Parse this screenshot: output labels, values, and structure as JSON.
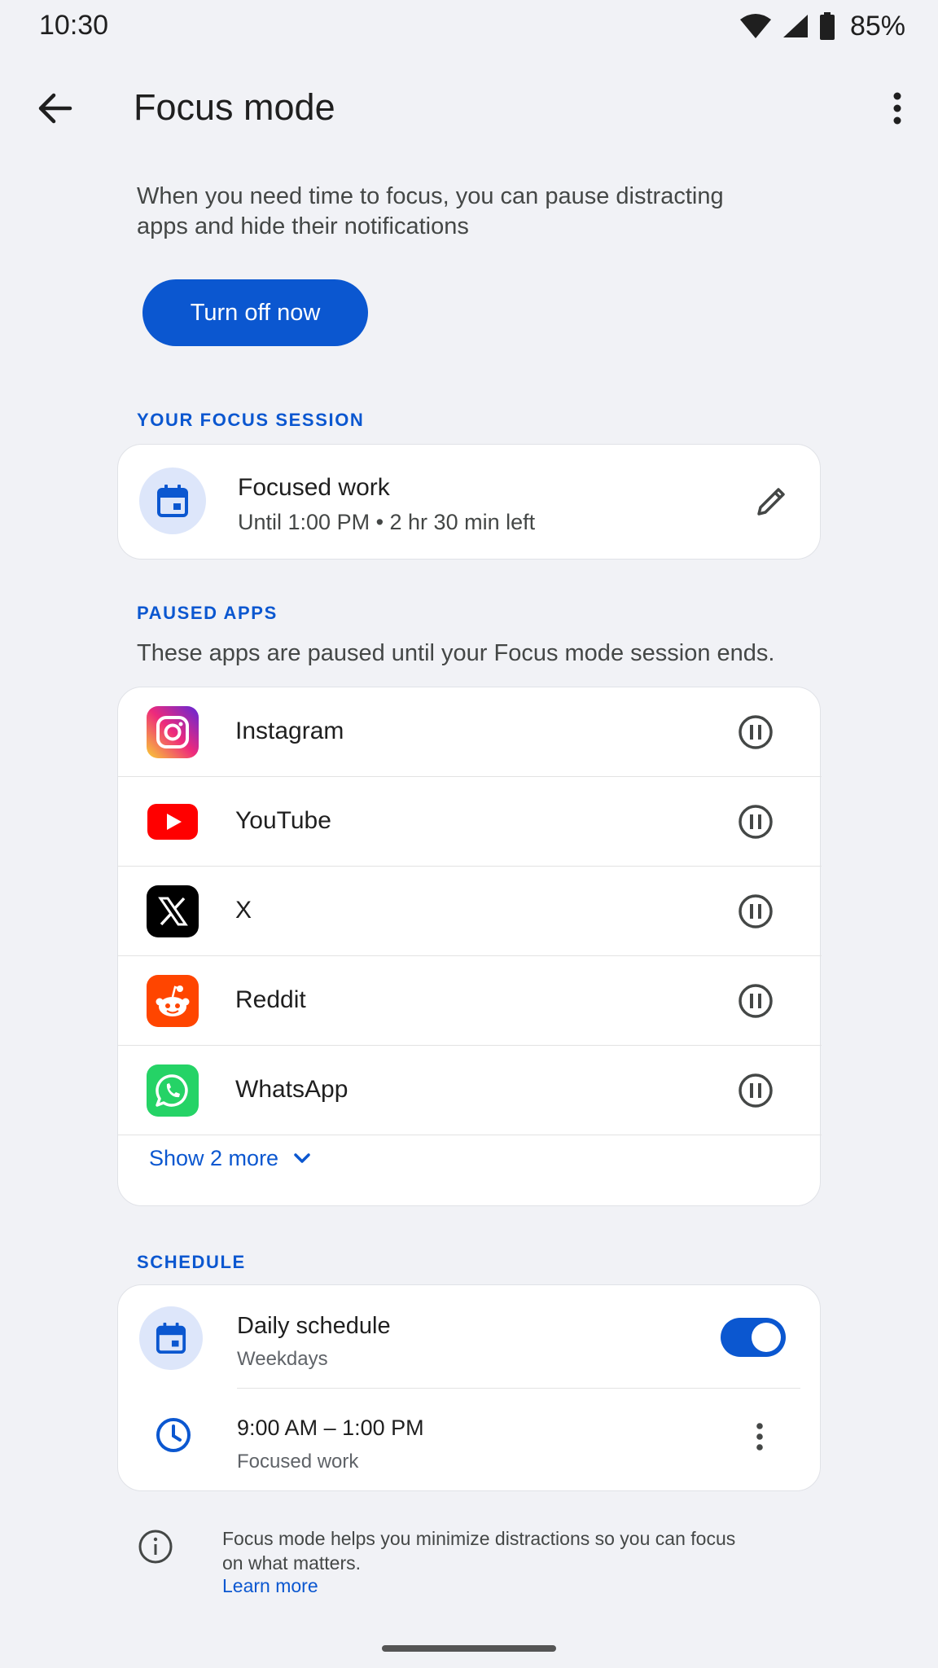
{
  "status_bar": {
    "time": "10:30",
    "battery": "85%"
  },
  "app_bar": {
    "title": "Focus mode"
  },
  "intro": "When you need time to focus, you can pause distracting apps and hide their notifications",
  "turn_off_button": "Turn off now",
  "focus_session": {
    "section_label": "YOUR FOCUS SESSION",
    "title": "Focused work",
    "subtitle": "Until 1:00 PM • 2 hr 30 min left"
  },
  "paused_apps": {
    "section_label": "PAUSED APPS",
    "description": "These apps are paused until your Focus mode session ends.",
    "apps": [
      {
        "name": "Instagram",
        "icon": "instagram-icon"
      },
      {
        "name": "YouTube",
        "icon": "youtube-icon"
      },
      {
        "name": "X",
        "icon": "x-icon"
      },
      {
        "name": "Reddit",
        "icon": "reddit-icon"
      },
      {
        "name": "WhatsApp",
        "icon": "whatsapp-icon"
      }
    ],
    "show_more": "Show 2 more"
  },
  "schedule": {
    "section_label": "SCHEDULE",
    "title": "Daily schedule",
    "subtitle": "Weekdays",
    "enabled": true,
    "time_range": "9:00 AM – 1:00 PM",
    "time_label": "Focused work"
  },
  "footer": {
    "text": "Focus mode helps you minimize distractions so you can focus on what matters.",
    "link": "Learn more"
  },
  "colors": {
    "accent": "#0b57d0",
    "background": "#f1f2f6",
    "card": "#ffffff"
  }
}
